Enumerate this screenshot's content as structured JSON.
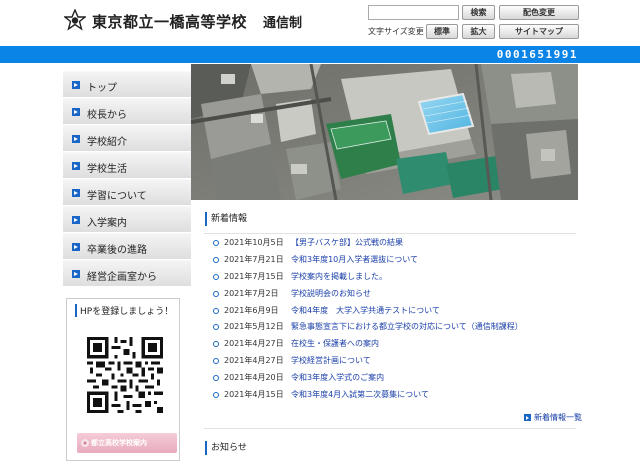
{
  "header": {
    "school_name": "東京都立一橋高等学校",
    "course_name": "通信制",
    "search_placeholder": "",
    "search_button": "検索",
    "color_button": "配色変更",
    "font_size_label": "文字サイズ変更",
    "standard_button": "標準",
    "large_button": "拡大",
    "sitemap_button": "サイトマップ"
  },
  "counter": "0001651991",
  "sidebar": {
    "items": [
      {
        "label": "トップ"
      },
      {
        "label": "校長から"
      },
      {
        "label": "学校紹介"
      },
      {
        "label": "学校生活"
      },
      {
        "label": "学習について"
      },
      {
        "label": "入学案内"
      },
      {
        "label": "卒業後の進路"
      },
      {
        "label": "経営企画室から"
      }
    ],
    "hp_title": "HPを登録しましょう！",
    "banner_text": "都立高校学校案内"
  },
  "news": {
    "heading": "新着情報",
    "items": [
      {
        "date": "2021年10月5日",
        "title": "【男子バスケ部】公式戦の結果"
      },
      {
        "date": "2021年7月21日",
        "title": "令和3年度10月入学者選抜について"
      },
      {
        "date": "2021年7月15日",
        "title": "学校案内を掲載しました。"
      },
      {
        "date": "2021年7月2日",
        "title": "学校説明会のお知らせ"
      },
      {
        "date": "2021年6月9日",
        "title": "令和4年度　大学入学共通テストについて"
      },
      {
        "date": "2021年5月12日",
        "title": "緊急事態宣言下における都立学校の対応について（通信制課程）"
      },
      {
        "date": "2021年4月27日",
        "title": "在校生・保護者への案内"
      },
      {
        "date": "2021年4月27日",
        "title": "学校経営計画について"
      },
      {
        "date": "2021年4月20日",
        "title": "令和3年度入学式のご案内"
      },
      {
        "date": "2021年4月15日",
        "title": "令和3年度4月入試第二次募集について"
      }
    ],
    "more_label": "新着情報一覧"
  },
  "notice": {
    "heading": "お知らせ"
  },
  "colors": {
    "accent_blue": "#0a84e6",
    "nav_square": "#1a66c7",
    "link_blue": "#1a3fa8"
  }
}
